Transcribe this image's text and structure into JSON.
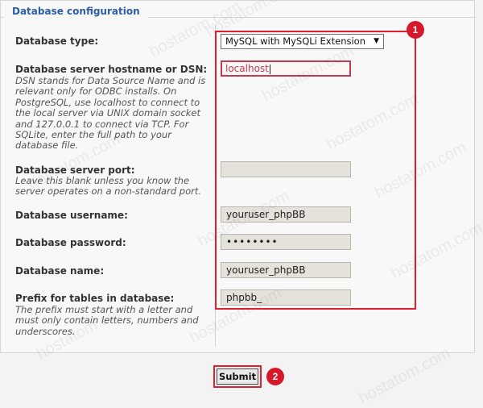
{
  "section": {
    "title": "Database configuration"
  },
  "fields": {
    "db_type": {
      "label": "Database type:",
      "value": "MySQL with MySQLi Extension"
    },
    "db_host": {
      "label": "Database server hostname or DSN:",
      "description": "DSN stands for Data Source Name and is relevant only for ODBC installs. On PostgreSQL, use localhost to connect to the local server via UNIX domain socket and 127.0.0.1 to connect via TCP. For SQLite, enter the full path to your database file.",
      "value": "localhost"
    },
    "db_port": {
      "label": "Database server port:",
      "description": "Leave this blank unless you know the server operates on a non-standard port.",
      "value": ""
    },
    "db_user": {
      "label": "Database username:",
      "value": "youruser_phpBB"
    },
    "db_pass": {
      "label": "Database password:",
      "value": "••••••••"
    },
    "db_name": {
      "label": "Database name:",
      "value": "youruser_phpBB"
    },
    "table_prefix": {
      "label": "Prefix for tables in database:",
      "description": "The prefix must start with a letter and must only contain letters, numbers and underscores.",
      "value": "phpbb_"
    }
  },
  "submit_label": "Submit",
  "annotations": {
    "badge_1": "1",
    "badge_2": "2"
  },
  "watermark": "hostatom.com",
  "colors": {
    "annotation_red": "#e0202a",
    "section_title_blue": "#2a5ea8"
  },
  "icons": {
    "select_arrow": "triangle-down-icon"
  }
}
